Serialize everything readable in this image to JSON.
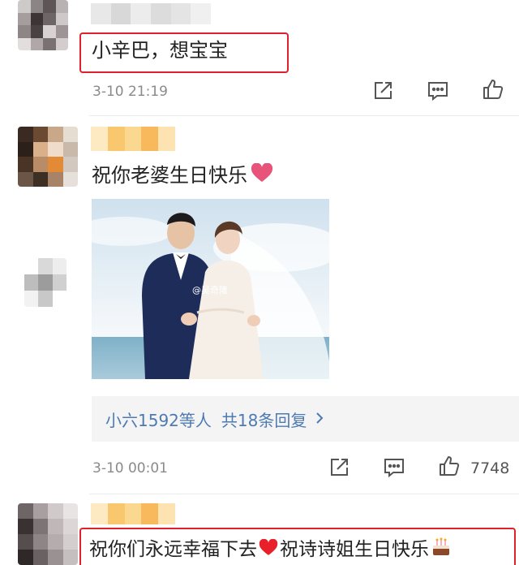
{
  "comments": [
    {
      "text": "小辛巴，想宝宝",
      "time": "3-10 21:19"
    },
    {
      "text": "祝你老婆生日快乐",
      "photo_watermark": "@吴奇隆",
      "reply_summary": {
        "names": "小六1592等人",
        "count_text": "共18条回复",
        "chevron": ">"
      },
      "time": "3-10 00:01",
      "likes": "7748"
    },
    {
      "text_part1": "祝你们永远幸福下去",
      "text_part2": "祝诗诗姐生日快乐"
    }
  ],
  "icons": {
    "share": "share-icon",
    "comment": "comment-icon",
    "like": "thumbs-up-icon",
    "heart": "heart-icon",
    "cake": "cake-icon"
  },
  "colors": {
    "highlight_box": "#e0202a",
    "link_blue": "#4d7ab3",
    "heart_pink": "#e8537a",
    "heart_red": "#e8202a",
    "meta_gray": "#8a8a8a"
  }
}
